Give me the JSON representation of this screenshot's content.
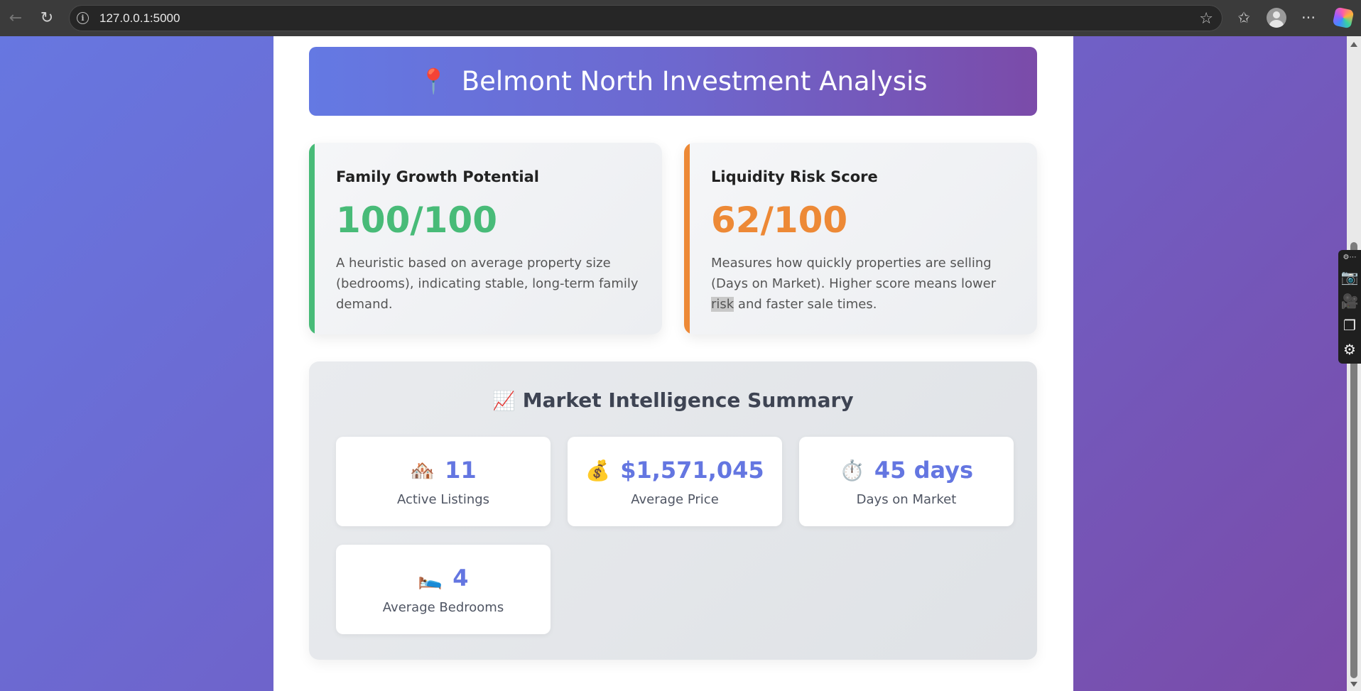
{
  "browser": {
    "url": "127.0.0.1:5000",
    "back_icon": "←",
    "reload_icon": "↻",
    "info_icon": "i",
    "star_icon": "☆",
    "favorites_icon": "✩",
    "more_icon": "···"
  },
  "side_toolbar": {
    "mini": "⚙⋯",
    "icons": [
      "📷",
      "🎥",
      "❐",
      "⚙"
    ]
  },
  "header": {
    "pin_icon": "📍",
    "title": "Belmont North Investment Analysis"
  },
  "metrics": [
    {
      "title": "Family Growth Potential",
      "value": "100/100",
      "description": "A heuristic based on average property size (bedrooms), indicating stable, long-term family demand.",
      "accent": "#48bb78"
    },
    {
      "title": "Liquidity Risk Score",
      "value": "62/100",
      "description_before": "Measures how quickly properties are selling (Days on Market). Higher score means lower ",
      "description_highlight": "risk",
      "description_after": " and faster sale times.",
      "accent": "#ed8936"
    }
  ],
  "summary": {
    "icon": "📈",
    "title": "Market Intelligence Summary",
    "stats": [
      {
        "icon": "🏘️",
        "value": "11",
        "label": "Active Listings"
      },
      {
        "icon": "💰",
        "value": "$1,571,045",
        "label": "Average Price"
      },
      {
        "icon": "⏱️",
        "value": "45 days",
        "label": "Days on Market"
      },
      {
        "icon": "🛌",
        "value": "4",
        "label": "Average Bedrooms"
      }
    ]
  },
  "colors": {
    "gradient_start": "#667eea",
    "gradient_end": "#764ba2",
    "stat_value": "#6476e1"
  }
}
